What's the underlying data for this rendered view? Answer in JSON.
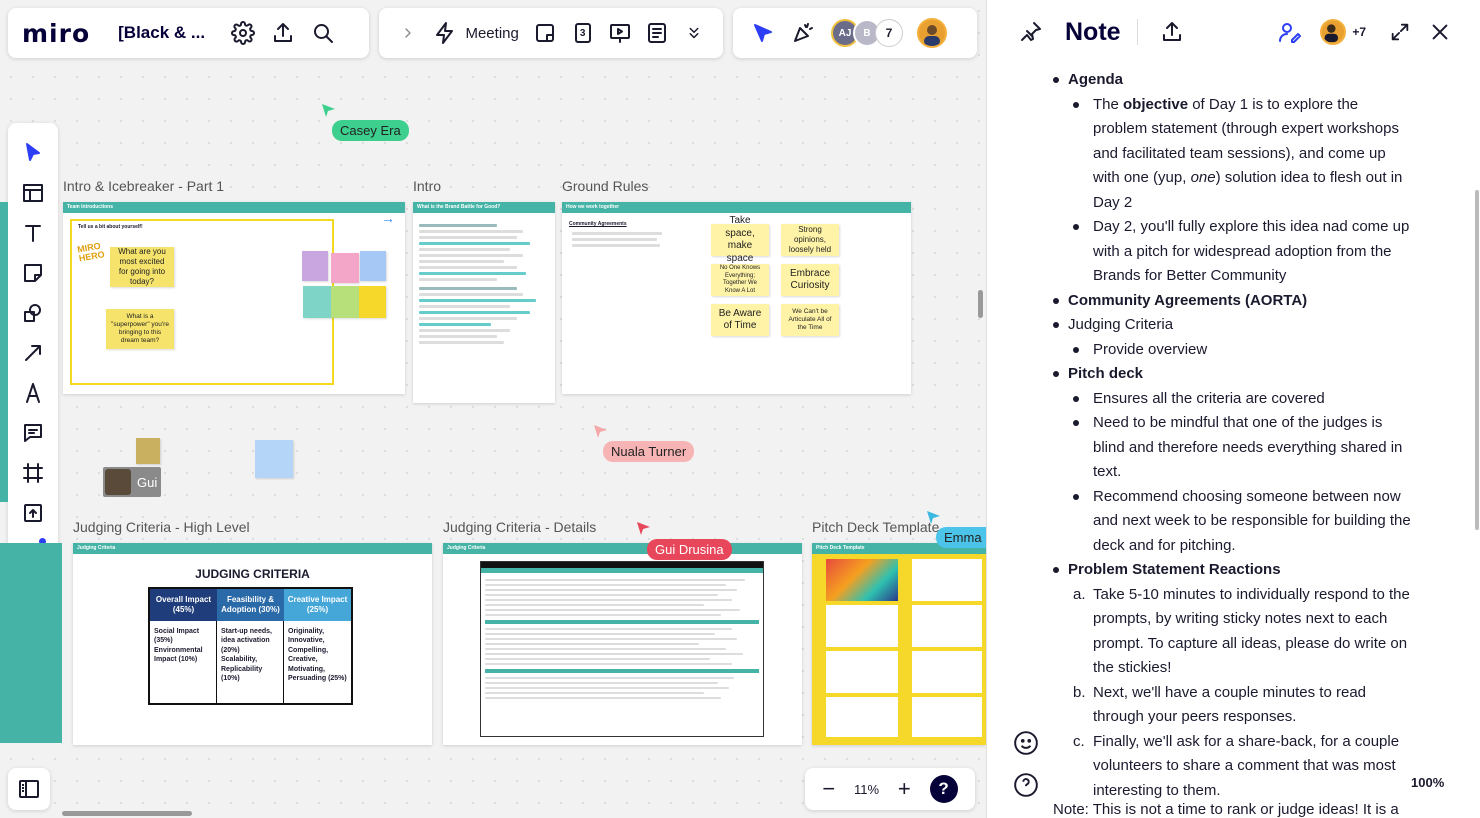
{
  "app": {
    "logo": "miro",
    "board_name": "[Black & ...",
    "meeting_label": "Meeting",
    "meeting_badge": "3"
  },
  "collaborators": {
    "initials_1": "AJ",
    "initials_2": "B",
    "count": "7"
  },
  "frames": {
    "intro_icebreaker": "Intro & Icebreaker - Part 1",
    "intro": "Intro",
    "ground_rules": "Ground Rules",
    "judging_high": "Judging Criteria - High Level",
    "judging_details": "Judging Criteria - Details",
    "pitch_deck": "Pitch Deck Template"
  },
  "frame_bars": {
    "team_intros": "Team Introductions",
    "brand_battle": "What is the Brand Battle for Good?",
    "work_together": "How we work together",
    "judging": "Judging Criteria",
    "judging2": "Judging Criteria",
    "pitch": "Pitch Deck Template"
  },
  "icebreaker": {
    "heading": "Tell us a bit about yourself!",
    "logo_text": "MIRO HERO",
    "sticky_1": "What are you most excited for going into today?",
    "sticky_2": "What is a \"superpower\" you're bringing to this dream team?"
  },
  "ground_rules": {
    "heading": "Community Agreements",
    "stickies": [
      "Take space, make space",
      "Strong opinions, loosely held",
      "No One Knows Everything; Together We Know A Lot",
      "Embrace Curiosity",
      "Be Aware of Time",
      "We Can't be Articulate All of the Time"
    ]
  },
  "judging": {
    "title": "JUDGING CRITERIA",
    "headers": [
      "Overall Impact (45%)",
      "Feasibility & Adoption (30%)",
      "Creative Impact (25%)"
    ],
    "cells": [
      "Social Impact (35%)\nEnvironmental Impact (10%)",
      "Start-up needs, idea activation (20%)\nScalability, Replicability (10%)",
      "Originality, Innovative, Compelling, Creative, Motivating, Persuading (25%)"
    ],
    "header_colors": [
      "#1f3d7a",
      "#2b6aa8",
      "#45a6d8"
    ]
  },
  "cursors": {
    "casey": "Casey Era",
    "nuala": "Nuala Turner",
    "gui_drusina": "Gui Drusina",
    "emma": "Emma B",
    "gui": "Gui"
  },
  "zoom": {
    "canvas_zoom": "11%",
    "help": "?"
  },
  "note": {
    "title": "Note",
    "extra_count": "+7",
    "zoom": "100%",
    "agenda": "Agenda",
    "obj_pre": "The ",
    "obj_bold": "objective",
    "obj_post_1": " of Day 1 is to explore the problem statement (through expert workshops and facilitated team sessions), and come up with one (yup, ",
    "obj_italic": "one",
    "obj_post_2": ") solution idea to flesh out in Day 2",
    "day2": "Day 2, you'll fully explore this idea nad come up with a pitch for widespread adoption from the Brands for Better Community",
    "aorta": "Community Agreements (AORTA)",
    "judging_criteria": "Judging Criteria",
    "provide_overview": "Provide overview",
    "pitch_deck": "Pitch deck",
    "pd_1": "Ensures all the criteria are covered",
    "pd_2": "Need to be mindful that one of the judges is blind and therefore needs everything shared in text.",
    "pd_3": "Recommend choosing someone between now and next week to be responsible for building the deck and for pitching.",
    "psr": "Problem Statement Reactions",
    "psr_a_num": "a.",
    "psr_a": "Take 5-10 minutes to individually respond to the prompts, by writing sticky notes next to each prompt.  To capture all ideas, please do write on the stickies!",
    "psr_b_num": "b.",
    "psr_b": "Next, we'll have a couple minutes to read through your peers responses.",
    "psr_c_num": "c.",
    "psr_c": "Finally, we'll ask for a share-back, for a couple volunteers to share a comment that was most interesting to them.",
    "tail": "Note: This is not a time to rank or judge ideas! It is a"
  }
}
